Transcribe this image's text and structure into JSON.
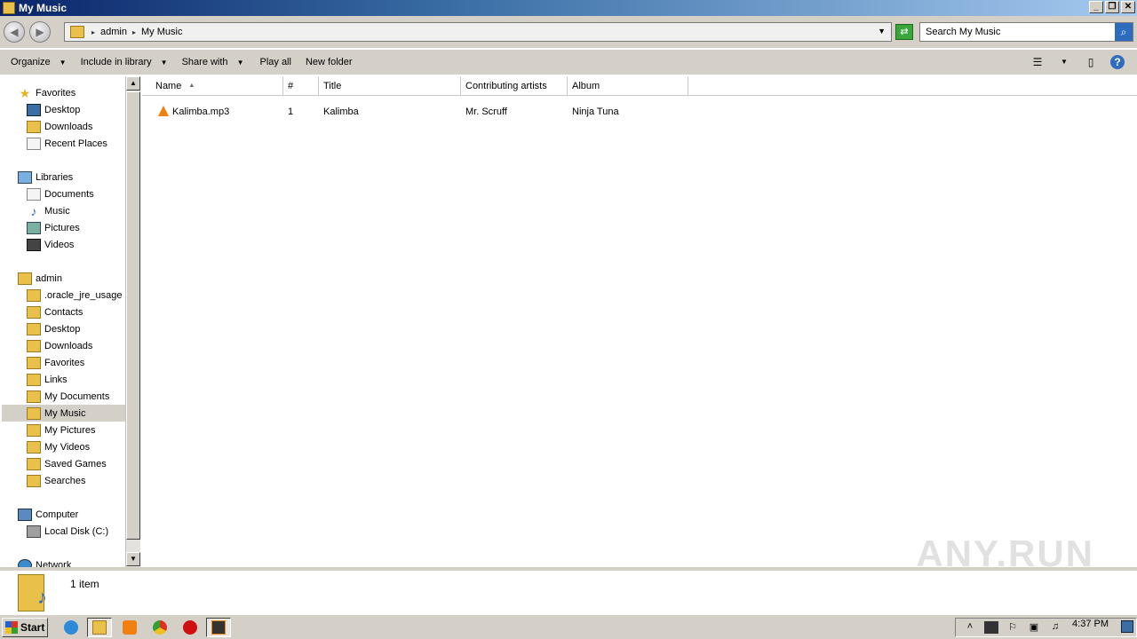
{
  "window": {
    "title": "My Music"
  },
  "address": {
    "crumbs": [
      "admin",
      "My Music"
    ],
    "search_placeholder": "Search My Music"
  },
  "toolbar": {
    "organize": "Organize",
    "include_in_library": "Include in library",
    "share_with": "Share with",
    "play_all": "Play all",
    "new_folder": "New folder"
  },
  "nav": {
    "favorites": "Favorites",
    "fav_items": [
      "Desktop",
      "Downloads",
      "Recent Places"
    ],
    "libraries": "Libraries",
    "lib_items": [
      "Documents",
      "Music",
      "Pictures",
      "Videos"
    ],
    "user": "admin",
    "user_items": [
      ".oracle_jre_usage",
      "Contacts",
      "Desktop",
      "Downloads",
      "Favorites",
      "Links",
      "My Documents",
      "My Music",
      "My Pictures",
      "My Videos",
      "Saved Games",
      "Searches"
    ],
    "computer": "Computer",
    "computer_items": [
      "Local Disk (C:)"
    ],
    "network": "Network",
    "selected": "My Music"
  },
  "columns": {
    "name": "Name",
    "number": "#",
    "title": "Title",
    "artists": "Contributing artists",
    "album": "Album"
  },
  "files": [
    {
      "name": "Kalimba.mp3",
      "number": "1",
      "title": "Kalimba",
      "artists": "Mr. Scruff",
      "album": "Ninja Tuna"
    }
  ],
  "status": {
    "count": "1 item"
  },
  "watermark": "ANY.RUN",
  "taskbar": {
    "start": "Start",
    "clock": "4:37 PM"
  }
}
